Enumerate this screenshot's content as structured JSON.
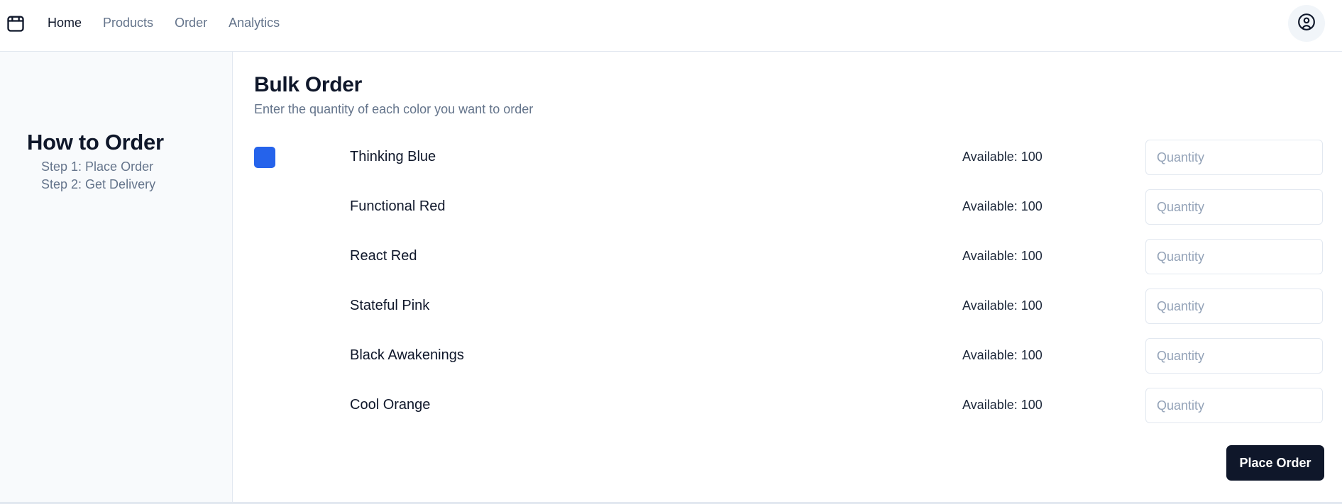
{
  "nav": {
    "logo_icon": "shopping-bag-icon",
    "items": [
      {
        "label": "Home",
        "active": true
      },
      {
        "label": "Products",
        "active": false
      },
      {
        "label": "Order",
        "active": false
      },
      {
        "label": "Analytics",
        "active": false
      }
    ],
    "avatar_icon": "user-circle-icon"
  },
  "sidebar": {
    "title": "How to Order",
    "steps": [
      "Step 1: Place Order",
      "Step 2: Get Delivery"
    ]
  },
  "main": {
    "title": "Bulk Order",
    "subtitle": "Enter the quantity of each color you want to order",
    "products": [
      {
        "name": "Thinking Blue",
        "available": "Available: 100",
        "placeholder": "Quantity",
        "swatch": "#2563eb"
      },
      {
        "name": "Functional Red",
        "available": "Available: 100",
        "placeholder": "Quantity",
        "swatch": ""
      },
      {
        "name": "React Red",
        "available": "Available: 100",
        "placeholder": "Quantity",
        "swatch": ""
      },
      {
        "name": "Stateful Pink",
        "available": "Available: 100",
        "placeholder": "Quantity",
        "swatch": ""
      },
      {
        "name": "Black Awakenings",
        "available": "Available: 100",
        "placeholder": "Quantity",
        "swatch": ""
      },
      {
        "name": "Cool Orange",
        "available": "Available: 100",
        "placeholder": "Quantity",
        "swatch": ""
      }
    ],
    "submit_label": "Place Order"
  },
  "colors": {
    "primary": "#0f172a",
    "muted_text": "#64748b",
    "sidebar_bg": "#f8fafc",
    "border": "#e2e8f0"
  }
}
